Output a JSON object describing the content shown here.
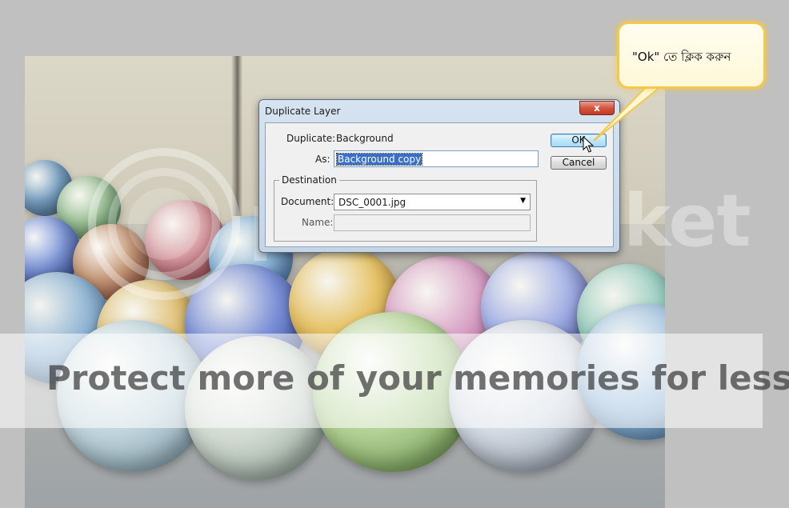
{
  "dialog": {
    "title": "Duplicate Layer",
    "close_label": "x",
    "duplicate_label": "Duplicate:",
    "duplicate_value": "Background",
    "as_label": "As:",
    "as_value": "Background copy",
    "destination_label": "Destination",
    "document_label": "Document:",
    "document_value": "DSC_0001.jpg",
    "name_label": "Name:",
    "name_value": "",
    "ok_label": "OK",
    "cancel_label": "Cancel"
  },
  "callout": {
    "text": "\"Ok\" তে ক্লিক   করুন"
  },
  "watermark": {
    "brand": "photobucket",
    "banner": "Protect more of your memories for less!"
  },
  "colors": {
    "callout_border": "#f5c84a",
    "default_button": "#bee6fd",
    "selection": "#3a6fc8"
  }
}
